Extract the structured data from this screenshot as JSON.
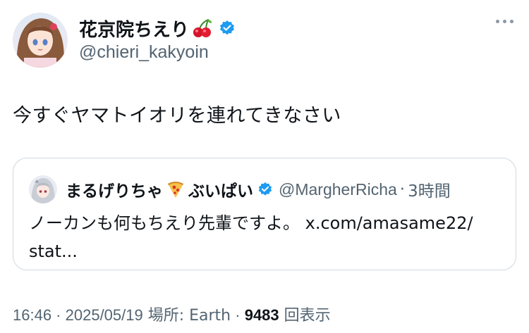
{
  "author": {
    "display_name": "花京院ちえり",
    "handle": "@chieri_kakyoin",
    "name_emoji": "cherry-emoji",
    "verified": true
  },
  "more_icon": "more-horizontal-icon",
  "tweet": {
    "text": "今すぐヤマトイオリを連れてきなさい"
  },
  "quote": {
    "display_name_part1": "まるげりちゃ",
    "name_emoji": "pizza-emoji",
    "display_name_part2": "ぶいぱい",
    "handle": "@MargherRicha",
    "separator": "·",
    "time": "3時間",
    "text_line1": "ノーカンも何もちえり先輩ですよ。 x.com/amasame22/",
    "text_line2": "stat...",
    "verified": true
  },
  "meta": {
    "time": "16:46",
    "sep1": " · ",
    "date": "2025/05/19",
    "location_label": " 場所: Earth",
    "sep2": " · ",
    "views_count": "9483",
    "views_label": " 回表示"
  },
  "colors": {
    "verified_blue": "#1d9bf0",
    "secondary_text": "#536471",
    "border": "#cfd9de"
  }
}
